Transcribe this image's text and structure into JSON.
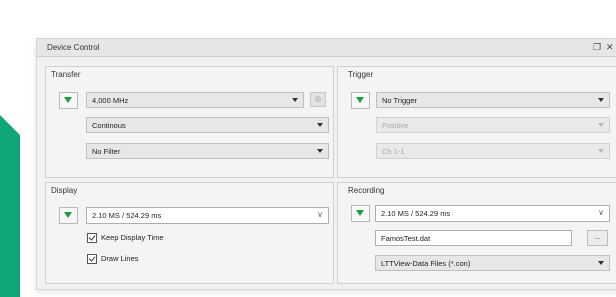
{
  "window": {
    "title": "Device Control",
    "pin_icon": "pin-icon",
    "close_icon": "close-icon"
  },
  "transfer": {
    "label": "Transfer",
    "rate": "4,000 MHz",
    "mode": "Continous",
    "filter": "No Filter"
  },
  "trigger": {
    "label": "Trigger",
    "source": "No Trigger",
    "slope": "Positive",
    "channel": "Ch 1-1"
  },
  "display": {
    "label": "Display",
    "value": "2.10 MS / 524.29 ms",
    "keep_display_time": "Keep Display Time",
    "draw_lines": "Draw Lines"
  },
  "recording": {
    "label": "Recording",
    "value": "2.10 MS / 524.29 ms",
    "filename": "FamosTest.dat",
    "browse": "...",
    "filetype": "LTTView-Data Files (*.con)"
  },
  "colors": {
    "accent": "#0fa77a",
    "play_green": "#1b9e42"
  }
}
